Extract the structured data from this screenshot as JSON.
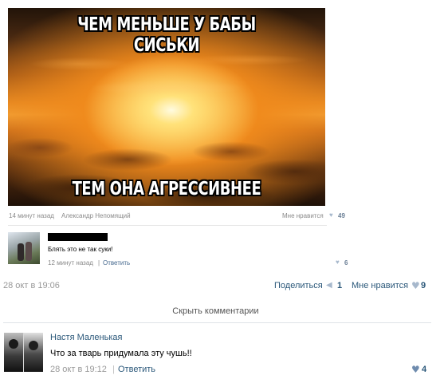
{
  "meme": {
    "caption_top": "ЧЕМ МЕНЬШЕ У БАБЫ СИСЬКИ",
    "caption_bottom": "ТЕМ ОНА АГРЕССИВНЕЕ"
  },
  "inner_post": {
    "time": "14 минут назад",
    "author": "Александр Непомящий",
    "like_label": "Мне нравится",
    "like_count": "49"
  },
  "inner_comment": {
    "text": "Блять это не так суки!",
    "time": "12 минут назад",
    "reply_label": "Ответить",
    "like_count": "6"
  },
  "post_footer": {
    "date": "28 окт в 19:06",
    "share_label": "Поделиться",
    "share_count": "1",
    "like_label": "Мне нравится",
    "like_count": "9"
  },
  "hide_comments_label": "Скрыть комментарии",
  "comment": {
    "author": "Настя Маленькая",
    "text": "Что за тварь придумала эту чушь!!",
    "date": "28 окт в 19:12",
    "reply_label": "Ответить",
    "like_count": "4"
  },
  "colors": {
    "link": "#2b587a",
    "muted": "#8a8a8a",
    "heart": "#a7b8cc"
  },
  "icons": [
    "heart-icon",
    "megaphone-icon"
  ]
}
